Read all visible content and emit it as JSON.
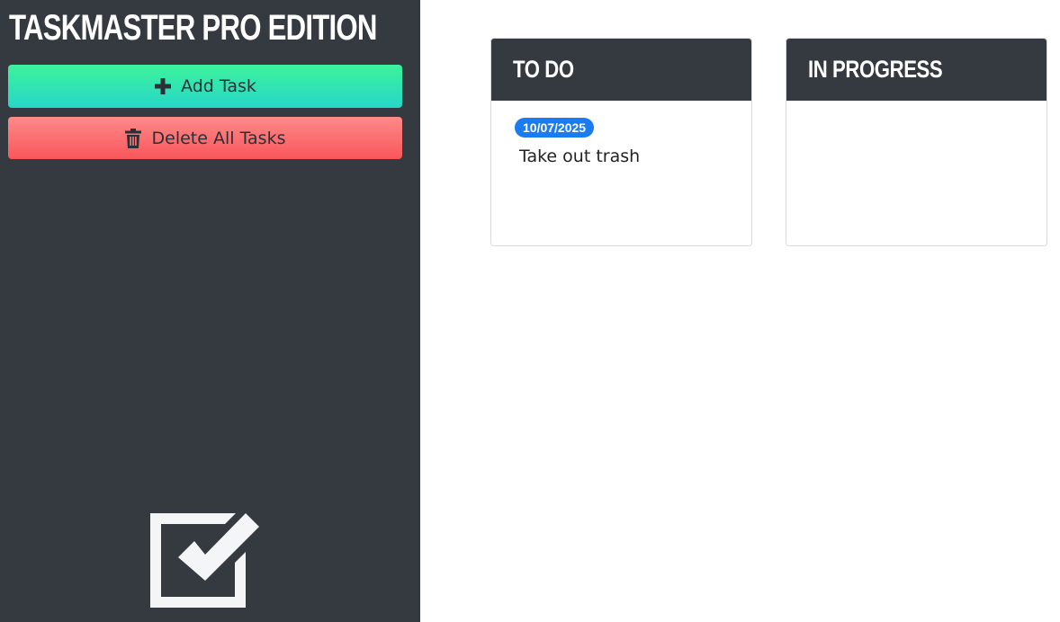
{
  "app": {
    "title": "TASKMASTER PRO EDITION"
  },
  "sidebar": {
    "add_label": "Add Task",
    "add_icon": "plus-icon",
    "delete_label": "Delete All Tasks",
    "delete_icon": "trash-icon",
    "logo_icon": "checkbox-checked-icon"
  },
  "board": {
    "columns": [
      {
        "title": "TO DO",
        "tasks": [
          {
            "due": "10/07/2025",
            "text": "Take out trash"
          }
        ]
      },
      {
        "title": "IN PROGRESS",
        "tasks": []
      }
    ]
  },
  "colors": {
    "sidebar_bg": "#353a41",
    "add_gradient_top": "#3df29b",
    "add_gradient_bottom": "#27d6c9",
    "delete_gradient_top": "#ff8a8a",
    "delete_gradient_bottom": "#f8565b",
    "badge_bg": "#1a7cf0"
  }
}
